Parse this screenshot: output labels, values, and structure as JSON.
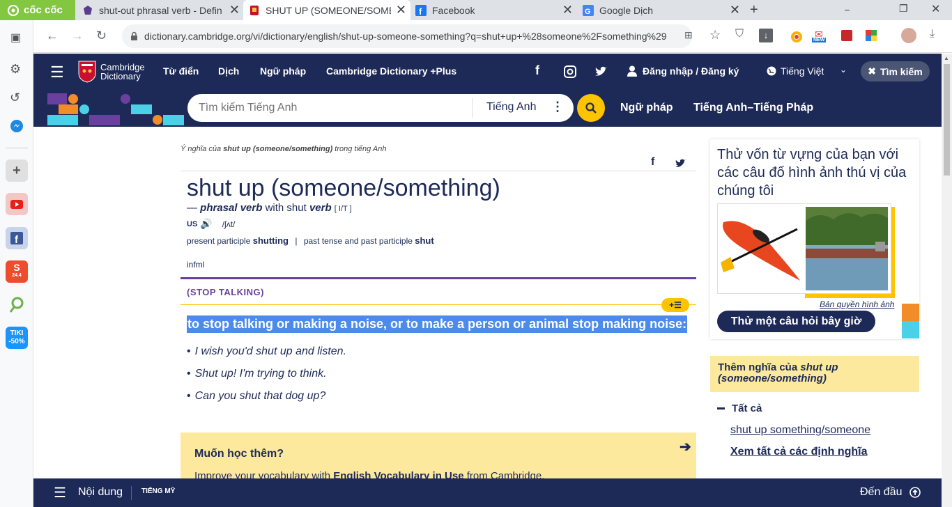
{
  "browser": {
    "brand": "cốc cốc",
    "tabs": [
      {
        "title": "shut-out phrasal verb - Defin",
        "active": false
      },
      {
        "title": "SHUT UP (SOMEONE/SOMETH",
        "active": true
      },
      {
        "title": "Facebook",
        "active": false
      },
      {
        "title": "Google Dịch",
        "active": false
      }
    ],
    "url": "dictionary.cambridge.org/vi/dictionary/english/shut-up-someone-something?q=shut+up+%28someone%2Fsomething%29",
    "new_badge": "NEW"
  },
  "left_sidebar": {
    "tiki_label": "TIKI",
    "tiki_discount": "-50%",
    "shopee_label": "S",
    "shopee_date": "24.4"
  },
  "header": {
    "logo_line1": "Cambridge",
    "logo_line2": "Dictionary",
    "nav": [
      "Từ điển",
      "Dịch",
      "Ngữ pháp",
      "Cambridge Dictionary +Plus"
    ],
    "login": "Đăng nhập / Đăng ký",
    "language": "Tiếng Việt",
    "search_btn": "Tìm kiếm"
  },
  "searchbar": {
    "placeholder": "Tìm kiếm Tiếng Anh",
    "lang": "Tiếng Anh",
    "links": [
      "Ngữ pháp",
      "Tiếng Anh–Tiếng Pháp"
    ]
  },
  "entry": {
    "meaning_prefix": "Ý nghĩa của",
    "meaning_word": "shut up (someone/something)",
    "meaning_suffix": "trong tiếng Anh",
    "headword": "shut up (someone/something)",
    "pos_dash": "—",
    "pos": "phrasal verb",
    "pos_with": "with shut",
    "pos_verb": "verb",
    "grammar": "[ I/T ]",
    "region": "US",
    "pron": "/ʃʌt/",
    "inflections": {
      "label1": "present participle",
      "form1": "shutting",
      "sep": "|",
      "label2": "past tense and past participle",
      "form2": "shut"
    },
    "register": "infml",
    "guideword": "(STOP TALKING)",
    "definition": "to stop talking or making a noise, or to make a person or animal stop making noise:",
    "examples": [
      "I wish you'd shut up and listen.",
      "Shut up! I'm trying to think.",
      "Can you shut that dog up?"
    ],
    "learn_more_title": "Muốn học thêm?",
    "learn_more_prefix": "Improve your vocabulary with",
    "learn_more_book": "English Vocabulary in Use",
    "learn_more_suffix": "from Cambridge."
  },
  "sidebar": {
    "quiz_title": "Thử vốn từ vựng của bạn với các câu đố hình ảnh thú vị của chúng tôi",
    "copyright": "Bản quyền hình ảnh",
    "quiz_btn": "Thử một câu hỏi bây giờ",
    "more_prefix": "Thêm nghĩa của",
    "more_word": "shut up (someone/something)",
    "all_label": "Tất cả",
    "link1": "shut up something/someone",
    "link2": "Xem tất cả các định nghĩa"
  },
  "footer": {
    "contents": "Nội dung",
    "dialect": "TIẾNG MỸ",
    "top": "Đến đầu"
  }
}
